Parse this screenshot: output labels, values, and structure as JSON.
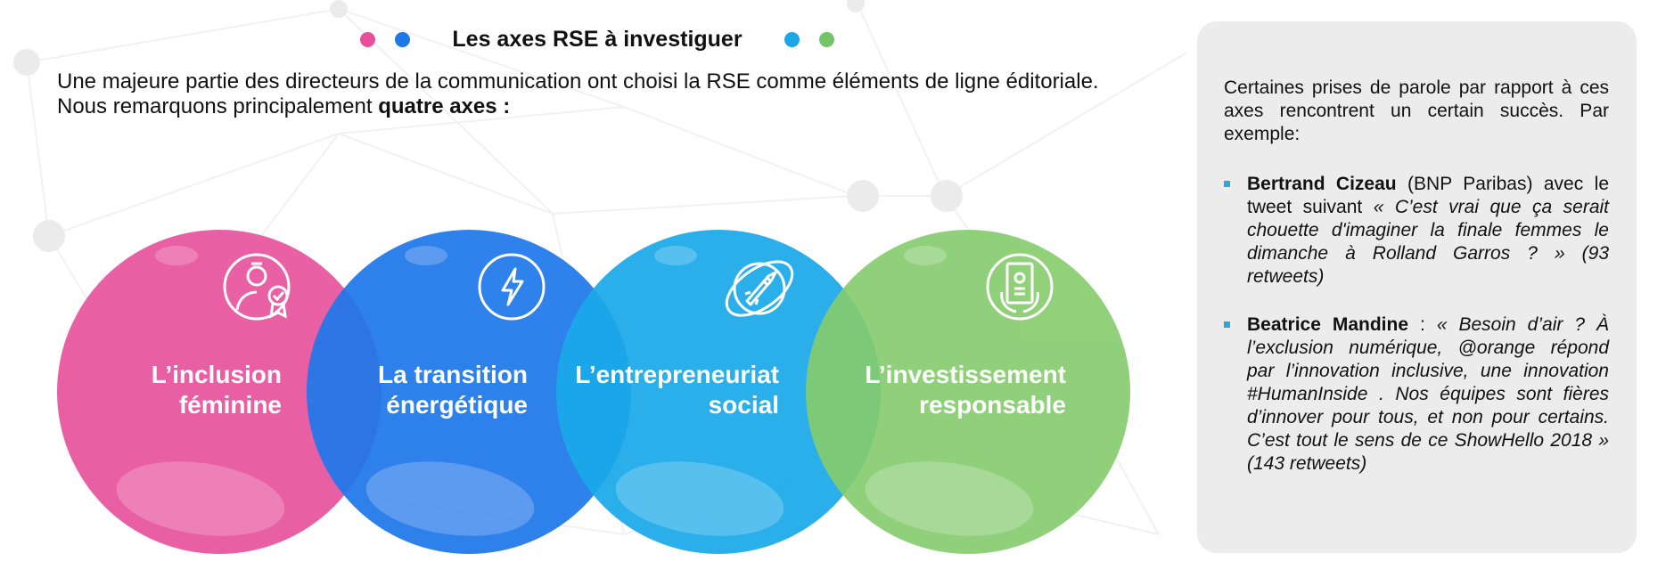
{
  "header": {
    "title": "Les axes RSE à investiguer",
    "dot_colors_left": [
      "#e84f9a",
      "#1f78e8"
    ],
    "dot_colors_right": [
      "#1aa7e6",
      "#74c46a"
    ]
  },
  "intro": {
    "line1": "Une majeure partie des directeurs de la communication ont choisi la RSE comme éléments de ligne éditoriale.",
    "line2_prefix": "Nous remarquons principalement ",
    "line2_bold": "quatre axes :"
  },
  "axes": [
    {
      "line1": "L’inclusion",
      "line2": "féminine",
      "color": "#e8579f",
      "icon": "woman-award-icon"
    },
    {
      "line1": "La transition",
      "line2": "énergétique",
      "color": "#1f77ea",
      "icon": "lightning-icon"
    },
    {
      "line1": "L’entrepreneuriat",
      "line2": "social",
      "color": "#1aa9ea",
      "icon": "rocket-icon"
    },
    {
      "line1": "L’investissement",
      "line2": "responsable",
      "color": "#85cc6c",
      "icon": "money-icon"
    }
  ],
  "panel": {
    "intro": "Certaines prises de parole par rapport à ces axes rencontrent un certain succès. Par exemple:",
    "quote1": {
      "name": "Bertrand Cizeau",
      "context": " (BNP Paribas) avec le tweet suivant ",
      "text": "« C’est vrai que ça serait chouette d'imaginer la finale femmes le dimanche à Rolland Garros ? »  (93 retweets)"
    },
    "quote2": {
      "name": "Beatrice Mandine",
      "context": " : ",
      "text": "« Besoin d’air ? À l’exclusion numérique, @orange répond par l’innovation inclusive, une innovation #HumanInside . Nos équipes sont fières d’innover pour tous, et non pour certains. C’est tout le sens de ce ShowHello 2018 » (143 retweets)"
    }
  }
}
